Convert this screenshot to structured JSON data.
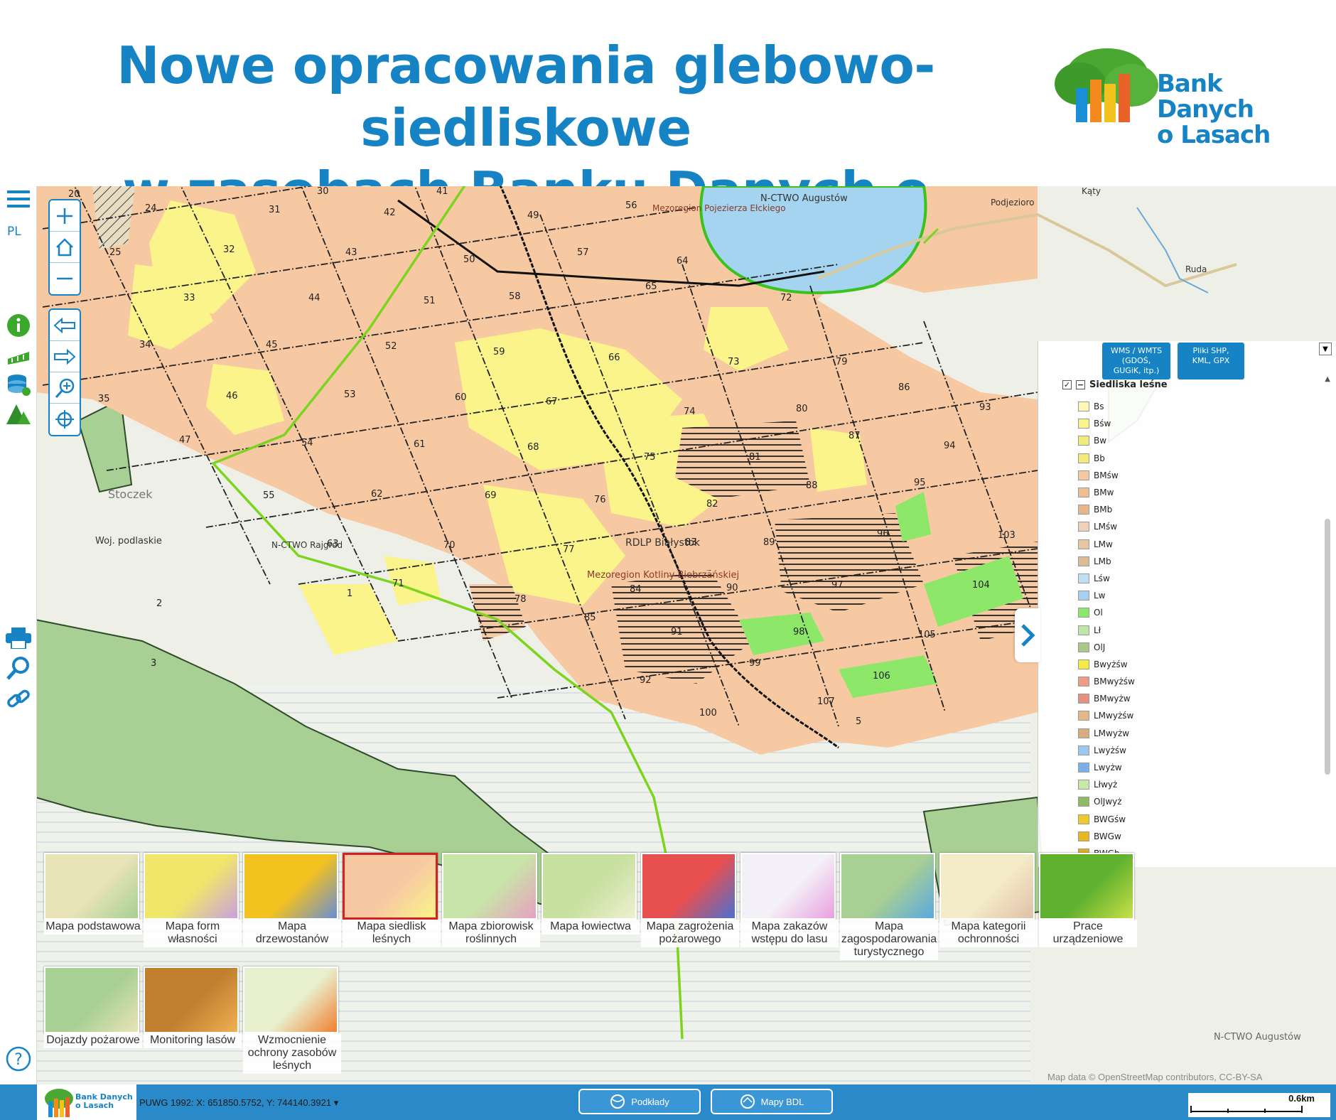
{
  "header": {
    "title_line1": "Nowe opracowania glebowo-siedliskowe",
    "title_line2": "w zasobach Banku Danych o Lasach",
    "logo_line1": "Bank Danych",
    "logo_line2": "o Lasach"
  },
  "toolbar": {
    "language": "PL",
    "icons": [
      "menu-icon",
      "info-icon",
      "measure-icon",
      "database-icon",
      "tree-icon",
      "print-icon",
      "search-icon",
      "link-icon",
      "help-icon",
      "accessibility-icon"
    ]
  },
  "map": {
    "labels": {
      "ctwo_augustow": "N-CTWO Augustów",
      "mezoregion_elckiego": "Mezoregion Pojezierza Ełckiego",
      "podjezioro": "Podjezioro",
      "katy": "Kąty",
      "ruda": "Ruda",
      "stoczek": "Stoczek",
      "woj": "Woj. podlaskie",
      "ctwo_rajgrod": "N-CTWO Rajgród",
      "rdlp": "RDLP Białystok",
      "mezoregion_kotliny": "Mezoregion Kotliny Biebrzańskiej",
      "ctwo_augustow2": "N-CTWO Augustów"
    },
    "compartments": [
      "20",
      "24",
      "25",
      "30",
      "31",
      "32",
      "33",
      "34",
      "35",
      "41",
      "42",
      "43",
      "44",
      "45",
      "46",
      "47",
      "49",
      "50",
      "51",
      "52",
      "53",
      "54",
      "55",
      "56",
      "57",
      "58",
      "59",
      "60",
      "61",
      "62",
      "63",
      "64",
      "65",
      "66",
      "67",
      "68",
      "69",
      "70",
      "71",
      "72",
      "73",
      "74",
      "75",
      "76",
      "77",
      "78",
      "79",
      "80",
      "81",
      "82",
      "83",
      "84",
      "85",
      "86",
      "87",
      "88",
      "89",
      "90",
      "91",
      "92",
      "93",
      "94",
      "95",
      "96",
      "97",
      "98",
      "99",
      "100",
      "103",
      "104",
      "105",
      "106",
      "107",
      "1",
      "2",
      "3",
      "5"
    ]
  },
  "legend": {
    "btn_wms": "WMS / WMTS (GDOŚ, GUGiK, itp.)",
    "btn_files": "Pliki SHP, KML, GPX",
    "layer_title": "Siedliska leśne",
    "items": [
      {
        "label": "Bs",
        "color": "#fdf6b8"
      },
      {
        "label": "Bśw",
        "color": "#faf48a"
      },
      {
        "label": "Bw",
        "color": "#f2ea7a"
      },
      {
        "label": "Bb",
        "color": "#f2ea7a"
      },
      {
        "label": "BMśw",
        "color": "#f7c9a2"
      },
      {
        "label": "BMw",
        "color": "#f0be94"
      },
      {
        "label": "BMb",
        "color": "#e9b58a"
      },
      {
        "label": "LMśw",
        "color": "#eed2b8"
      },
      {
        "label": "LMw",
        "color": "#e6c6a4"
      },
      {
        "label": "LMb",
        "color": "#dcbb96"
      },
      {
        "label": "Lśw",
        "color": "#bfe0f4"
      },
      {
        "label": "Lw",
        "color": "#a6d0ee"
      },
      {
        "label": "Ol",
        "color": "#8de86a"
      },
      {
        "label": "Lł",
        "color": "#bde6a8"
      },
      {
        "label": "OlJ",
        "color": "#a8c98a"
      },
      {
        "label": "Bwyżśw",
        "color": "#f7ea44"
      },
      {
        "label": "BMwyżśw",
        "color": "#f09a88"
      },
      {
        "label": "BMwyżw",
        "color": "#e89080"
      },
      {
        "label": "LMwyżśw",
        "color": "#e2b888"
      },
      {
        "label": "LMwyżw",
        "color": "#d8ac80"
      },
      {
        "label": "Lwyżśw",
        "color": "#9cc8f0"
      },
      {
        "label": "Lwyżw",
        "color": "#7ab0e6"
      },
      {
        "label": "Lłwyż",
        "color": "#c6e8a8"
      },
      {
        "label": "OlJwyż",
        "color": "#8ebc66"
      },
      {
        "label": "BWGśw",
        "color": "#f0c830"
      },
      {
        "label": "BWGw",
        "color": "#e8b820"
      },
      {
        "label": "BWGb",
        "color": "#e0b020"
      }
    ]
  },
  "thumbnails": [
    {
      "label": "Mapa podstawowa"
    },
    {
      "label": "Mapa form własności"
    },
    {
      "label": "Mapa drzewostanów"
    },
    {
      "label": "Mapa siedlisk leśnych"
    },
    {
      "label": "Mapa zbiorowisk roślinnych"
    },
    {
      "label": "Mapa łowiectwa"
    },
    {
      "label": "Mapa zagrożenia pożarowego"
    },
    {
      "label": "Mapa zakazów wstępu do lasu"
    },
    {
      "label": "Mapa zagospodarowania turystycznego"
    },
    {
      "label": "Mapa kategorii ochronności"
    },
    {
      "label": "Prace urządzeniowe"
    },
    {
      "label": "Dojazdy pożarowe"
    },
    {
      "label": "Monitoring lasów"
    },
    {
      "label": "Wzmocnienie ochrony zasobów leśnych"
    }
  ],
  "bottom": {
    "coords": "PUWG 1992: X: 651850.5752, Y: 744140.3921",
    "btn_podklady": "Podkłady",
    "btn_mapy": "Mapy BDL",
    "map_data": "Map data © OpenStreetMap contributors, CC-BY-SA",
    "scale": "0.6km",
    "logo_line1": "Bank Danych",
    "logo_line2": "o Lasach"
  },
  "colors": {
    "brand_blue": "#1683c4",
    "active_red": "#d32020",
    "forest_green": "#8dbf7a"
  }
}
